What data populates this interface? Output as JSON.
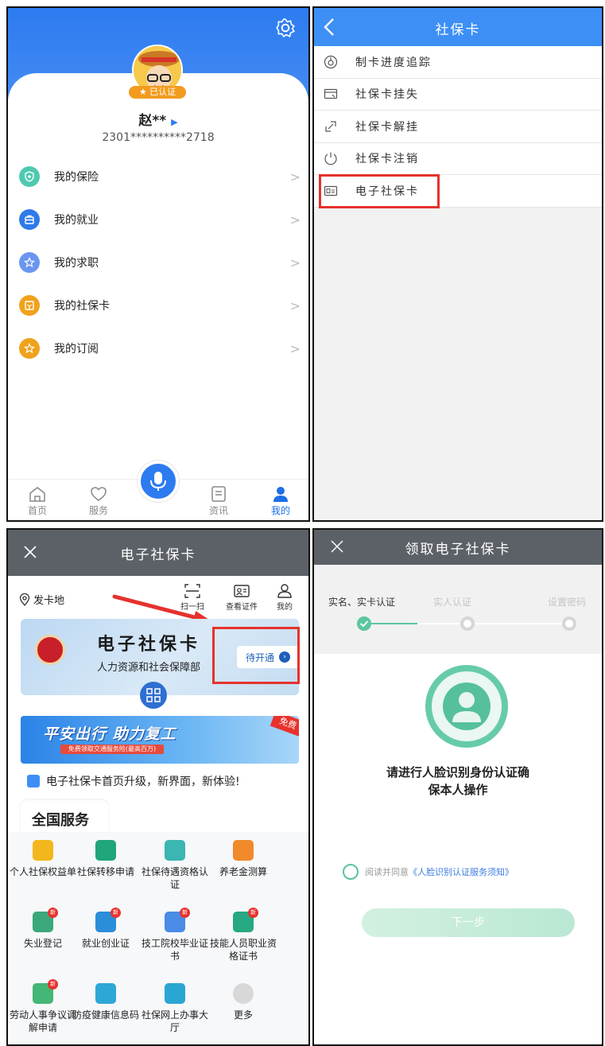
{
  "profile": {
    "auth_badge": "已认证",
    "name": "赵**",
    "id_number": "2301**********2718",
    "menu": [
      {
        "label": "我的保险",
        "icon": "shield-icon",
        "color": "#4fc9b0"
      },
      {
        "label": "我的就业",
        "icon": "briefcase-icon",
        "color": "#2f7ae8"
      },
      {
        "label": "我的求职",
        "icon": "star-icon",
        "color": "#6b96ef"
      },
      {
        "label": "我的社保卡",
        "icon": "card-icon",
        "color": "#f0a21c"
      },
      {
        "label": "我的订阅",
        "icon": "star-icon",
        "color": "#f0a21c"
      }
    ],
    "menu_arrow": ">",
    "tabs": {
      "home": "首页",
      "service": "服务",
      "news": "资讯",
      "mine": "我的"
    }
  },
  "card_menu": {
    "title": "社保卡",
    "items": [
      {
        "label": "制卡进度追踪",
        "icon": "progress-icon"
      },
      {
        "label": "社保卡挂失",
        "icon": "card-lost-icon"
      },
      {
        "label": "社保卡解挂",
        "icon": "unlink-icon"
      },
      {
        "label": "社保卡注销",
        "icon": "power-icon"
      },
      {
        "label": "电子社保卡",
        "icon": "id-card-icon"
      }
    ]
  },
  "ecard_home": {
    "title": "电子社保卡",
    "location_label": "发卡地",
    "quick": {
      "scan": "扫一扫",
      "certs": "查看证件",
      "mine": "我的"
    },
    "card_title": "电子社保卡",
    "card_issuer": "人力资源和社会保障部",
    "open_button": "待开通",
    "banner_text": "平安出行 助力复工",
    "banner_sub": "免费领取交通服务险(最高百万)",
    "banner_tag": "免费",
    "notice": "电子社保卡首页升级，新界面，新体验!",
    "services_title": "全国服务",
    "services": [
      {
        "label": "个人社保权益单",
        "color": "#f2b71d",
        "new": false
      },
      {
        "label": "社保转移申请",
        "color": "#21a57a",
        "new": false
      },
      {
        "label": "社保待遇资格认证",
        "color": "#3bb6b0",
        "new": false
      },
      {
        "label": "养老金测算",
        "color": "#f08a2a",
        "new": false
      },
      {
        "label": "失业登记",
        "color": "#3aa87a",
        "new": true
      },
      {
        "label": "就业创业证",
        "color": "#2b8ed8",
        "new": true
      },
      {
        "label": "技工院校毕业证书",
        "color": "#4a8be6",
        "new": true
      },
      {
        "label": "技能人员职业资格证书",
        "color": "#26a882",
        "new": true
      },
      {
        "label": "劳动人事争议调解申请",
        "color": "#44b676",
        "new": true
      },
      {
        "label": "防疫健康信息码",
        "color": "#2fa7d6",
        "new": false
      },
      {
        "label": "社保网上办事大厅",
        "color": "#2aa6d2",
        "new": false
      },
      {
        "label": "更多",
        "color": "#d8d8d8",
        "new": false
      }
    ],
    "new_badge": "新"
  },
  "receive": {
    "title": "领取电子社保卡",
    "steps": [
      "实名、实卡认证",
      "实人认证",
      "设置密码"
    ],
    "prompt_line1": "请进行人脸识别身份认证确",
    "prompt_line2": "保本人操作",
    "agree_prefix": "阅读并同意",
    "agree_link": "《人脸识别认证服务须知》",
    "next_button": "下一步"
  }
}
